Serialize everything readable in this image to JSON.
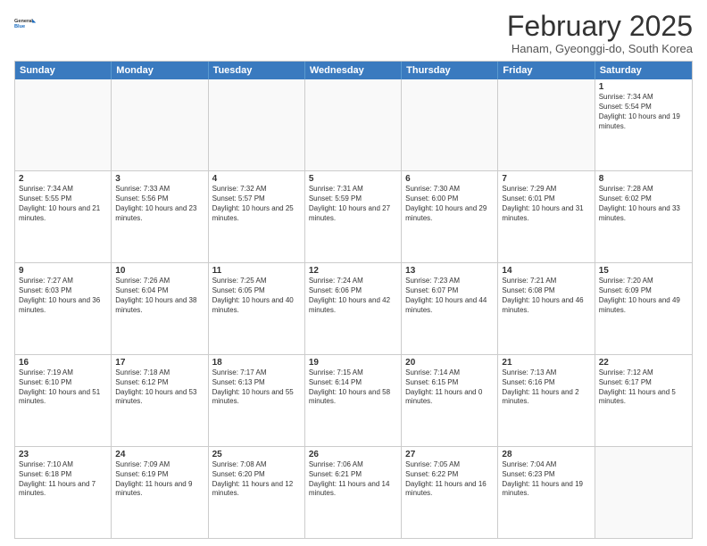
{
  "header": {
    "logo_line1": "General",
    "logo_line2": "Blue",
    "month_year": "February 2025",
    "location": "Hanam, Gyeonggi-do, South Korea"
  },
  "days_of_week": [
    "Sunday",
    "Monday",
    "Tuesday",
    "Wednesday",
    "Thursday",
    "Friday",
    "Saturday"
  ],
  "weeks": [
    [
      {
        "day": "",
        "text": ""
      },
      {
        "day": "",
        "text": ""
      },
      {
        "day": "",
        "text": ""
      },
      {
        "day": "",
        "text": ""
      },
      {
        "day": "",
        "text": ""
      },
      {
        "day": "",
        "text": ""
      },
      {
        "day": "1",
        "text": "Sunrise: 7:34 AM\nSunset: 5:54 PM\nDaylight: 10 hours and 19 minutes."
      }
    ],
    [
      {
        "day": "2",
        "text": "Sunrise: 7:34 AM\nSunset: 5:55 PM\nDaylight: 10 hours and 21 minutes."
      },
      {
        "day": "3",
        "text": "Sunrise: 7:33 AM\nSunset: 5:56 PM\nDaylight: 10 hours and 23 minutes."
      },
      {
        "day": "4",
        "text": "Sunrise: 7:32 AM\nSunset: 5:57 PM\nDaylight: 10 hours and 25 minutes."
      },
      {
        "day": "5",
        "text": "Sunrise: 7:31 AM\nSunset: 5:59 PM\nDaylight: 10 hours and 27 minutes."
      },
      {
        "day": "6",
        "text": "Sunrise: 7:30 AM\nSunset: 6:00 PM\nDaylight: 10 hours and 29 minutes."
      },
      {
        "day": "7",
        "text": "Sunrise: 7:29 AM\nSunset: 6:01 PM\nDaylight: 10 hours and 31 minutes."
      },
      {
        "day": "8",
        "text": "Sunrise: 7:28 AM\nSunset: 6:02 PM\nDaylight: 10 hours and 33 minutes."
      }
    ],
    [
      {
        "day": "9",
        "text": "Sunrise: 7:27 AM\nSunset: 6:03 PM\nDaylight: 10 hours and 36 minutes."
      },
      {
        "day": "10",
        "text": "Sunrise: 7:26 AM\nSunset: 6:04 PM\nDaylight: 10 hours and 38 minutes."
      },
      {
        "day": "11",
        "text": "Sunrise: 7:25 AM\nSunset: 6:05 PM\nDaylight: 10 hours and 40 minutes."
      },
      {
        "day": "12",
        "text": "Sunrise: 7:24 AM\nSunset: 6:06 PM\nDaylight: 10 hours and 42 minutes."
      },
      {
        "day": "13",
        "text": "Sunrise: 7:23 AM\nSunset: 6:07 PM\nDaylight: 10 hours and 44 minutes."
      },
      {
        "day": "14",
        "text": "Sunrise: 7:21 AM\nSunset: 6:08 PM\nDaylight: 10 hours and 46 minutes."
      },
      {
        "day": "15",
        "text": "Sunrise: 7:20 AM\nSunset: 6:09 PM\nDaylight: 10 hours and 49 minutes."
      }
    ],
    [
      {
        "day": "16",
        "text": "Sunrise: 7:19 AM\nSunset: 6:10 PM\nDaylight: 10 hours and 51 minutes."
      },
      {
        "day": "17",
        "text": "Sunrise: 7:18 AM\nSunset: 6:12 PM\nDaylight: 10 hours and 53 minutes."
      },
      {
        "day": "18",
        "text": "Sunrise: 7:17 AM\nSunset: 6:13 PM\nDaylight: 10 hours and 55 minutes."
      },
      {
        "day": "19",
        "text": "Sunrise: 7:15 AM\nSunset: 6:14 PM\nDaylight: 10 hours and 58 minutes."
      },
      {
        "day": "20",
        "text": "Sunrise: 7:14 AM\nSunset: 6:15 PM\nDaylight: 11 hours and 0 minutes."
      },
      {
        "day": "21",
        "text": "Sunrise: 7:13 AM\nSunset: 6:16 PM\nDaylight: 11 hours and 2 minutes."
      },
      {
        "day": "22",
        "text": "Sunrise: 7:12 AM\nSunset: 6:17 PM\nDaylight: 11 hours and 5 minutes."
      }
    ],
    [
      {
        "day": "23",
        "text": "Sunrise: 7:10 AM\nSunset: 6:18 PM\nDaylight: 11 hours and 7 minutes."
      },
      {
        "day": "24",
        "text": "Sunrise: 7:09 AM\nSunset: 6:19 PM\nDaylight: 11 hours and 9 minutes."
      },
      {
        "day": "25",
        "text": "Sunrise: 7:08 AM\nSunset: 6:20 PM\nDaylight: 11 hours and 12 minutes."
      },
      {
        "day": "26",
        "text": "Sunrise: 7:06 AM\nSunset: 6:21 PM\nDaylight: 11 hours and 14 minutes."
      },
      {
        "day": "27",
        "text": "Sunrise: 7:05 AM\nSunset: 6:22 PM\nDaylight: 11 hours and 16 minutes."
      },
      {
        "day": "28",
        "text": "Sunrise: 7:04 AM\nSunset: 6:23 PM\nDaylight: 11 hours and 19 minutes."
      },
      {
        "day": "",
        "text": ""
      }
    ]
  ]
}
